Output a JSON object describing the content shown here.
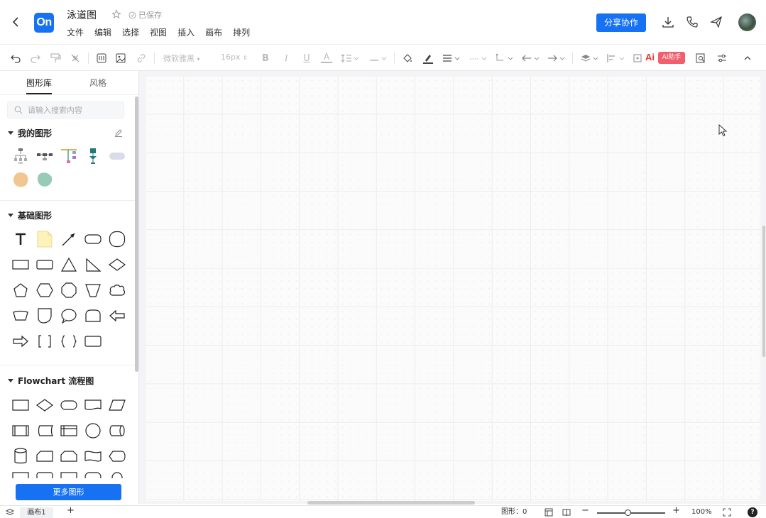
{
  "header": {
    "logo_text": "On",
    "doc_title": "泳道图",
    "save_status": "已保存",
    "menu": [
      "文件",
      "编辑",
      "选择",
      "视图",
      "插入",
      "画布",
      "排列"
    ],
    "share_label": "分享协作"
  },
  "toolbar": {
    "font_family": "微软雅黑",
    "font_size": "16px",
    "ai_label": "AI助手"
  },
  "sidebar": {
    "tabs": [
      "图形库",
      "风格"
    ],
    "search_placeholder": "请输入搜索内容",
    "sections": {
      "mine": "我的图形",
      "basic": "基础图形",
      "flowchart": "Flowchart 流程图"
    },
    "more_shapes_label": "更多图形"
  },
  "statusbar": {
    "page_tab": "画布1",
    "add_page": "+",
    "shape_count_label": "图形：0",
    "zoom_minus": "−",
    "zoom_plus": "+",
    "zoom_level": "100%",
    "help": "?"
  },
  "colors": {
    "accent": "#1672f3",
    "ai_badge": "#f15f6d"
  }
}
